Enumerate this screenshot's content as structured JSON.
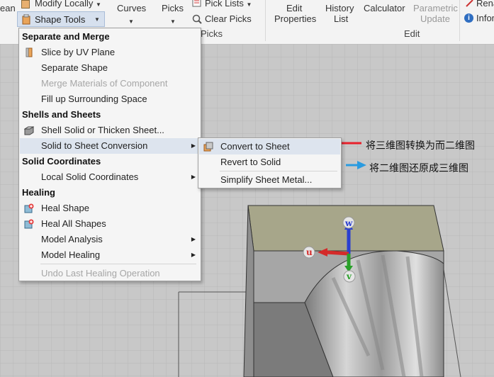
{
  "ribbon": {
    "partial_clean": "ean",
    "modify_locally": "Modify Locally",
    "shape_tools": "Shape Tools",
    "curves": "Curves",
    "picks": "Picks",
    "pick_lists": "Pick Lists",
    "clear_picks": "Clear Picks",
    "picks_group": "Picks",
    "edit_properties_line1": "Edit",
    "edit_properties_line2": "Properties",
    "history_list_line1": "History",
    "history_list_line2": "List",
    "calculator": "Calculator",
    "parametric_update_line1": "Parametric",
    "parametric_update_line2": "Update",
    "edit_group": "Edit",
    "partial_rename": "Rena",
    "partial_info": "Infor"
  },
  "menu": {
    "sections": [
      {
        "header": "Separate and Merge"
      },
      {
        "header": "Shells and Sheets"
      },
      {
        "header": "Solid Coordinates"
      },
      {
        "header": "Healing"
      }
    ],
    "items": {
      "slice_by_uv_plane": "Slice by UV Plane",
      "separate_shape": "Separate Shape",
      "merge_materials": "Merge Materials of Component",
      "fill_up_space": "Fill up Surrounding Space",
      "shell_solid": "Shell Solid or Thicken Sheet...",
      "solid_to_sheet": "Solid to Sheet Conversion",
      "local_solid_coords": "Local Solid Coordinates",
      "heal_shape": "Heal Shape",
      "heal_all_shapes": "Heal All Shapes",
      "model_analysis": "Model Analysis",
      "model_healing": "Model Healing",
      "undo_last_healing": "Undo Last Healing Operation"
    }
  },
  "submenu": {
    "convert_to_sheet": "Convert to Sheet",
    "revert_to_solid": "Revert to Solid",
    "simplify_sheet_metal": "Simplify Sheet Metal..."
  },
  "annotations": {
    "red_note": "将三维图转换为而二维图",
    "blue_note": "将二维图还原成三维图"
  },
  "axes": {
    "u": "u",
    "v": "v",
    "w": "w"
  },
  "colors": {
    "highlight": "#dde4ee",
    "annotation_red": "#e8202a",
    "annotation_blue": "#2a9be0",
    "axis_u": "#d42a2a",
    "axis_v": "#2aa02a",
    "axis_w": "#2a3fd0"
  }
}
